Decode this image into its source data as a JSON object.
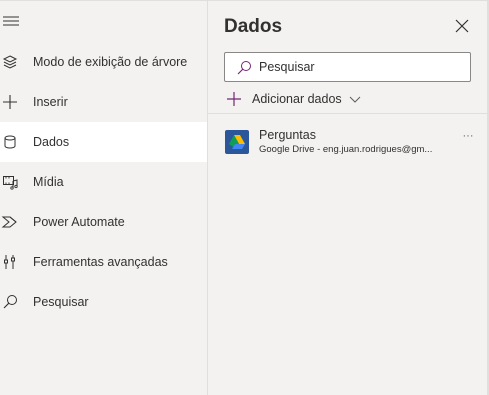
{
  "nav": {
    "items": [
      {
        "label": "Modo de exibição de árvore",
        "icon": "layers-icon"
      },
      {
        "label": "Inserir",
        "icon": "plus-icon"
      },
      {
        "label": "Dados",
        "icon": "database-icon",
        "active": true
      },
      {
        "label": "Mídia",
        "icon": "media-icon"
      },
      {
        "label": "Power Automate",
        "icon": "power-automate-icon"
      },
      {
        "label": "Ferramentas avançadas",
        "icon": "advanced-tools-icon"
      },
      {
        "label": "Pesquisar",
        "icon": "search-icon"
      }
    ]
  },
  "panel": {
    "title": "Dados",
    "search_placeholder": "Pesquisar",
    "add_data_label": "Adicionar dados",
    "sources": [
      {
        "name": "Perguntas",
        "detail": "Google Drive - eng.juan.rodrigues@gm...",
        "icon": "google-drive-icon"
      }
    ],
    "more_label": "···"
  },
  "colors": {
    "accent": "#742774",
    "active_bg": "#ffffff",
    "panel_bg": "#f3f2f1",
    "drive_tile": "#2b579a"
  }
}
